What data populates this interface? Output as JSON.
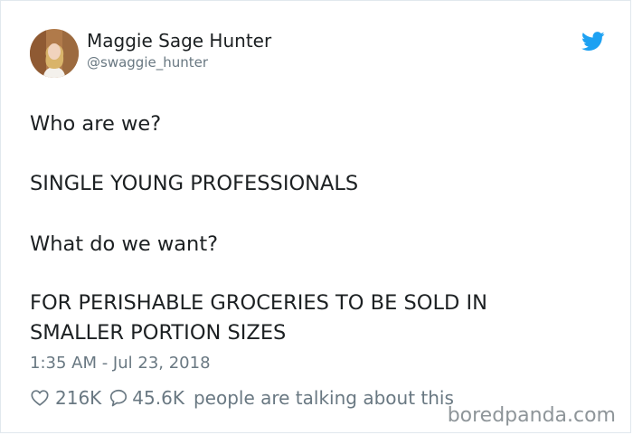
{
  "author": {
    "name": "Maggie Sage Hunter",
    "handle": "@swaggie_hunter"
  },
  "tweet": {
    "lines": [
      "Who are we?",
      "SINGLE YOUNG PROFESSIONALS",
      "What do we want?",
      "FOR PERISHABLE GROCERIES TO BE SOLD IN",
      "SMALLER PORTION SIZES"
    ],
    "timestamp": "1:35 AM - Jul 23, 2018"
  },
  "stats": {
    "likes": "216K",
    "replies": "45.6K",
    "talking_text": "people are talking about this"
  },
  "watermark": "boredpanda.com",
  "icons": {
    "brand": "twitter-bird-icon",
    "like": "heart-icon",
    "reply": "speech-bubble-icon"
  },
  "colors": {
    "text": "#1c2022",
    "secondary_text": "#697882",
    "twitter_blue": "#1da1f2",
    "card_border": "#e1e8ed",
    "watermark": "#8e9599"
  }
}
